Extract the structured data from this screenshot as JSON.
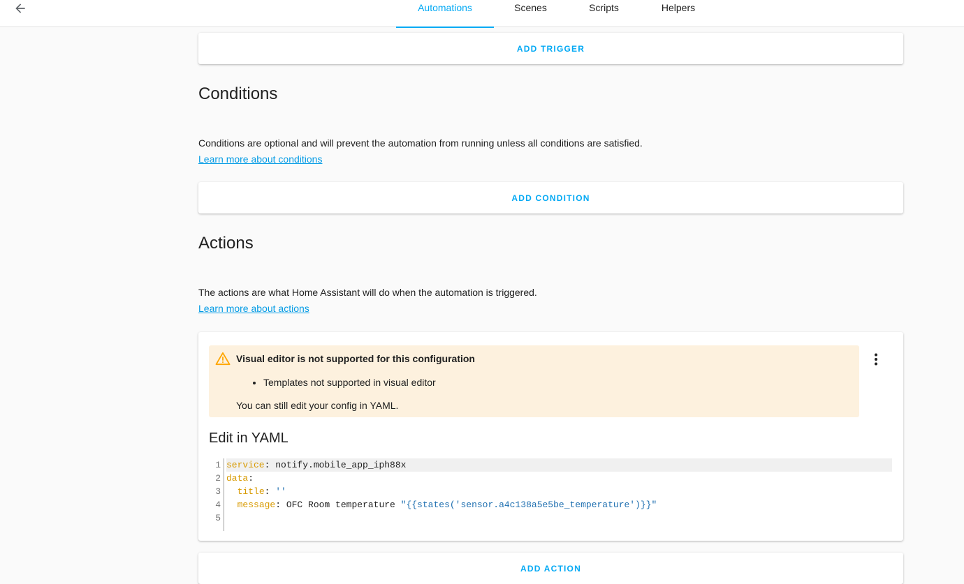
{
  "header": {
    "tabs": [
      {
        "label": "Automations",
        "active": true
      },
      {
        "label": "Scenes",
        "active": false
      },
      {
        "label": "Scripts",
        "active": false
      },
      {
        "label": "Helpers",
        "active": false
      }
    ]
  },
  "triggers": {
    "add_label": "ADD TRIGGER"
  },
  "conditions": {
    "title": "Conditions",
    "description": "Conditions are optional and will prevent the automation from running unless all conditions are satisfied.",
    "learn_more": "Learn more about conditions",
    "add_label": "ADD CONDITION"
  },
  "actions": {
    "title": "Actions",
    "description": "The actions are what Home Assistant will do when the automation is triggered.",
    "learn_more": "Learn more about actions",
    "add_label": "ADD ACTION",
    "warning": {
      "title": "Visual editor is not supported for this configuration",
      "items": [
        "Templates not supported in visual editor"
      ],
      "note": "You can still edit your config in YAML."
    },
    "yaml_title": "Edit in YAML",
    "yaml": {
      "line_numbers": [
        "1",
        "2",
        "3",
        "4",
        "5"
      ],
      "line1_key": "service",
      "line1_value": "notify.mobile_app_iph88x",
      "line2_key": "data",
      "line3_key": "title",
      "line3_value": "''",
      "line4_key": "message",
      "line4_value_plain": "OFC Room temperature ",
      "line4_value_string": "\"{{states('sensor.a4c138a5e5be_temperature')}}\""
    }
  },
  "colors": {
    "accent": "#03a9f4",
    "warning_bg": "#fdf1de",
    "warning_icon": "#ffa600",
    "yaml_key": "#d89a00",
    "yaml_string": "#1e6fb0"
  },
  "icons": {
    "back": "arrow-left-icon",
    "warning": "alert-triangle-icon",
    "menu": "dots-vertical-icon"
  }
}
